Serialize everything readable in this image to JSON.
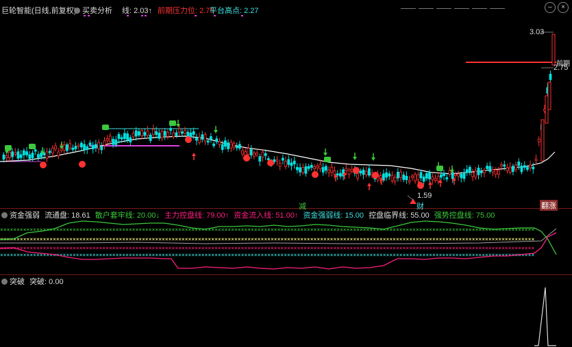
{
  "main": {
    "name": "巨轮智能(日线,前复权)",
    "indicator": "买卖分析",
    "line": "线: 2.03↑",
    "prev_pressure": "前期压力位: 2.75",
    "platform_high": "平台高点: 2.27",
    "high_label": "3.03",
    "low_label": "1.59",
    "pressure_label": "2.75",
    "marker_qiangqi": "前期",
    "marker_jian": "减",
    "marker_cai": "财",
    "marker_fanzhang": "翻涨"
  },
  "panel2": {
    "name": "资金强弱",
    "liutong": "流通盘: 18.61",
    "sanhu": "散户套牢线: 20.00↓",
    "zhuli": "主力控盘线: 79.00↑",
    "liuru": "资金流入线: 51.00↑",
    "qiangruo": "资金强弱线: 15.00",
    "linjie": "控盘临界线: 55.00",
    "qiangshi": "强势控盘线: 75.00"
  },
  "panel3": {
    "name": "突破",
    "value": "突破: 0.00"
  },
  "colors": {
    "up": "#ff3232",
    "down": "#00e0e0",
    "ma": "#ffffff",
    "green": "#3cc83c",
    "pink": "#ff2080",
    "cyan": "#40e0e0",
    "yellow": "#ffff80",
    "magenta": "#e040e0"
  },
  "icons": [
    "minimize-icon",
    "close-icon",
    "down-arrow-icon",
    "up-arrow-icon",
    "money-icon",
    "treasure-icon"
  ]
}
